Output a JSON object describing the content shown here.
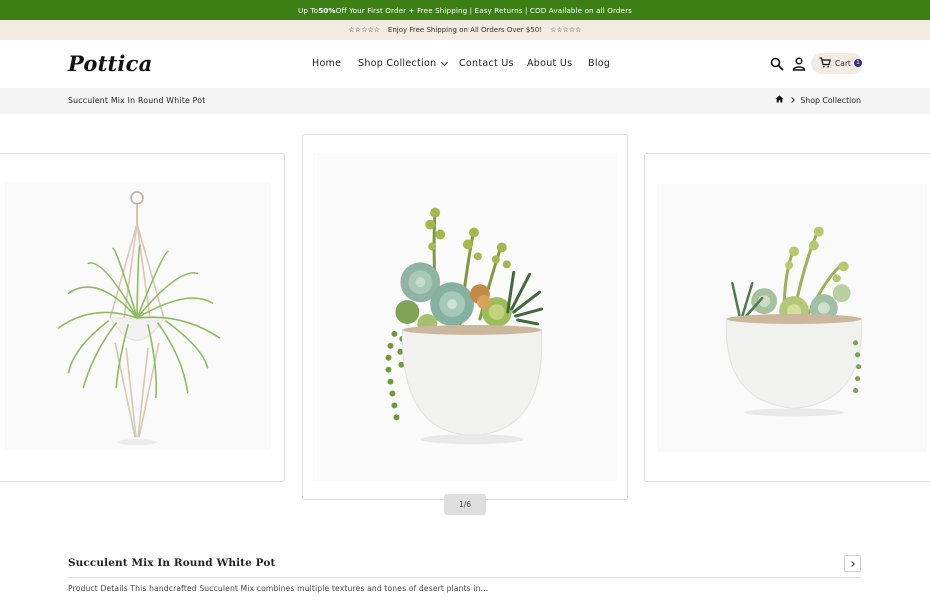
{
  "promo": {
    "text_before": "Up To ",
    "highlight": "50%",
    "text_after": " Off Your First Order + Free Shipping | Easy Returns | COD Available on all Orders"
  },
  "shipping_bar": {
    "stars_left": "☆☆☆☆☆",
    "text": "Enjoy Free Shipping on All Orders Over $50!",
    "stars_right": "☆☆☆☆☆"
  },
  "header": {
    "logo": "Pottica",
    "nav": {
      "home": "Home",
      "shop": "Shop Collection",
      "contact": "Contact Us",
      "about": "About Us",
      "blog": "Blog"
    },
    "cart_label": "Cart",
    "cart_count": "1"
  },
  "breadcrumb": {
    "title": "Succulent Mix In Round White Pot",
    "current": "Shop Collection"
  },
  "gallery": {
    "pager": "1/6"
  },
  "product": {
    "title": "Succulent Mix In Round White Pot",
    "description": "Product Details This handcrafted Succulent Mix combines multiple textures and tones of desert plants in..."
  },
  "colors": {
    "promo_bg": "#3c7f14",
    "ship_bg": "#f4ebe2",
    "cart_badge": "#3b2a84"
  },
  "icons": [
    "search-icon",
    "user-icon",
    "cart-icon",
    "home-icon",
    "chevron-down-icon",
    "chevron-right-icon"
  ]
}
